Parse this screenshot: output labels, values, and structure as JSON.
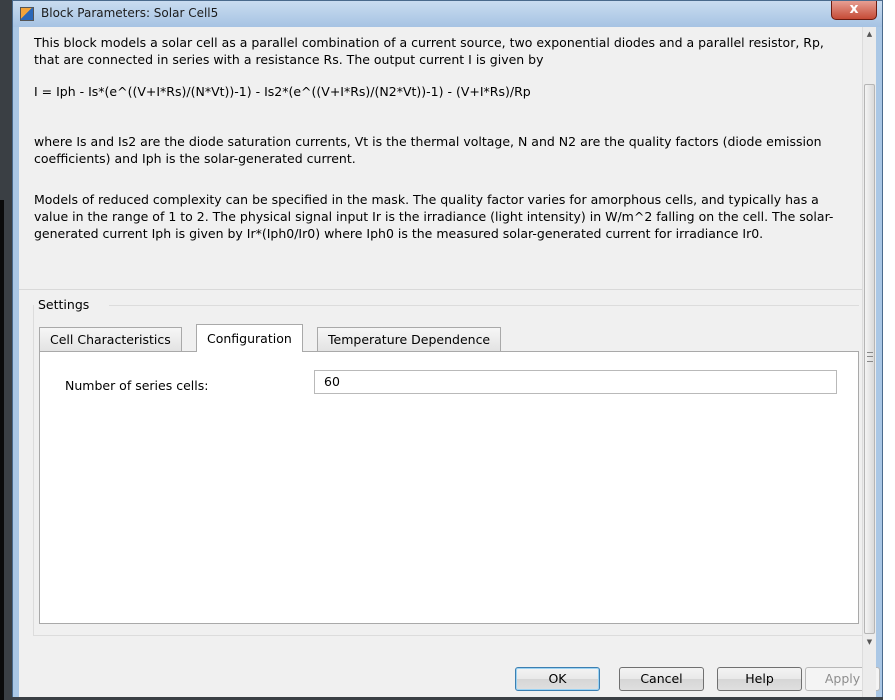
{
  "window": {
    "title": "Block Parameters: Solar Cell5",
    "close_label": "x"
  },
  "description": {
    "paragraph1": "This block models a solar cell as a parallel combination of a current source, two exponential diodes and a parallel resistor, Rp, that are connected in series with a resistance Rs. The output current I is given by",
    "equation": "I = Iph - Is*(e^((V+I*Rs)/(N*Vt))-1) - Is2*(e^((V+I*Rs)/(N2*Vt))-1) - (V+I*Rs)/Rp",
    "paragraph2": "where Is and Is2 are the diode saturation currents, Vt is the thermal voltage, N and N2 are the quality factors (diode emission coefficients) and Iph is the solar-generated current.",
    "paragraph3": "Models of reduced complexity can be specified in the mask. The quality factor varies for amorphous cells, and typically has a value in the range of 1 to 2. The physical signal input Ir is the irradiance (light intensity) in W/m^2 falling on the cell. The solar-generated current Iph is given by Ir*(Iph0/Ir0) where Iph0 is the measured solar-generated current for irradiance Ir0."
  },
  "settings": {
    "group_label": "Settings",
    "tabs": [
      {
        "label": "Cell Characteristics",
        "active": false
      },
      {
        "label": "Configuration",
        "active": true
      },
      {
        "label": "Temperature Dependence",
        "active": false
      }
    ],
    "fields": [
      {
        "label": "Number of series cells:",
        "value": "60"
      }
    ]
  },
  "buttons": {
    "ok": "OK",
    "cancel": "Cancel",
    "help": "Help",
    "apply": "Apply"
  },
  "colors": {
    "titlebar": "#aac7e5",
    "close_button": "#c54b36",
    "ok_focus": "#3c7fb1"
  }
}
